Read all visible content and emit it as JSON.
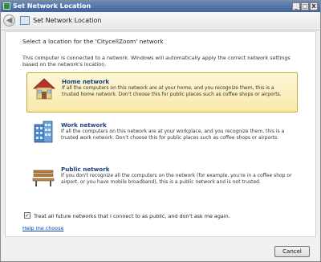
{
  "window": {
    "title": "Set Network Location",
    "minimize": "_",
    "maximize": "□",
    "close": "X"
  },
  "header": {
    "back": "◀",
    "title": "Set Network Location"
  },
  "main": {
    "heading": "Select a location for the 'CitycellZoom' network",
    "intro": "This computer is connected to a network. Windows will automatically apply the correct network settings based on the network's location.",
    "options": [
      {
        "title": "Home network",
        "description": "If all the computers on this network are at your home, and you recognize them, this is a trusted home network.  Don't choose this for public places such as coffee shops or airports.",
        "icon": "house-icon",
        "selected": true
      },
      {
        "title": "Work network",
        "description": "If all the computers on this network are at your workplace, and you recognize them, this is a trusted work network.  Don't choose this for public places such as coffee shops or airports.",
        "icon": "office-building-icon",
        "selected": false
      },
      {
        "title": "Public network",
        "description": "If you don't recognize all the computers on the network (for example, you're in a coffee shop or airport, or you have mobile broadband), this is a public network and is not trusted.",
        "icon": "park-bench-icon",
        "selected": false
      }
    ],
    "checkbox": {
      "checked": true,
      "mark": "✓",
      "label": "Treat all future networks that I connect to as public, and don't ask me again."
    },
    "help_link": "Help me choose"
  },
  "footer": {
    "cancel": "Cancel"
  },
  "colors": {
    "titlebar": "#40639a",
    "selected_fill": "#f8e9a8",
    "link": "#0645ad",
    "option_title": "#1b3f7a"
  }
}
